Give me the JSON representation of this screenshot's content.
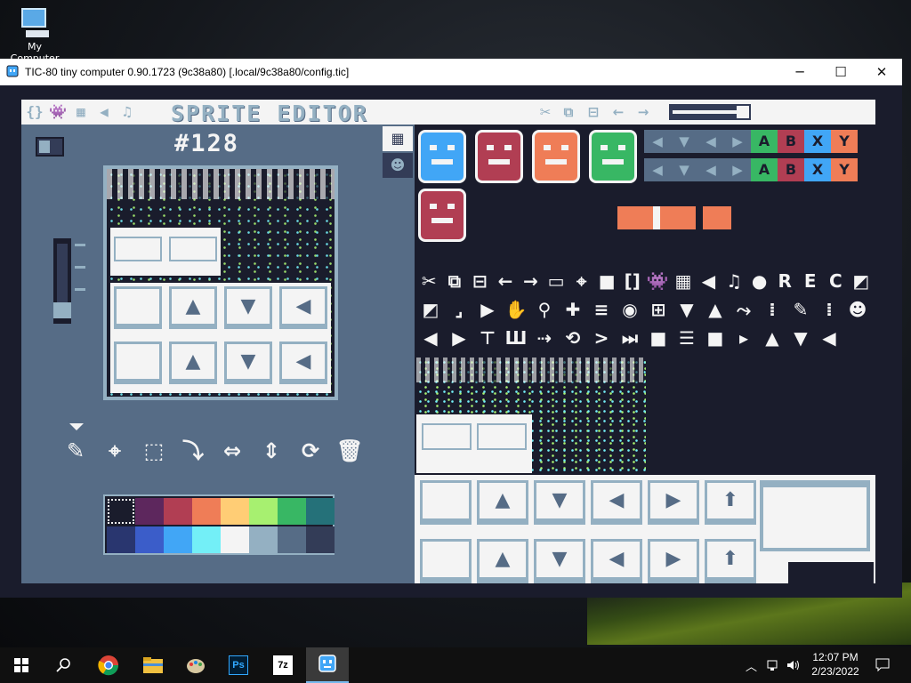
{
  "desktop": {
    "icon_label": "My Computer"
  },
  "window": {
    "title": "TIC-80 tiny computer 0.90.1723 (9c38a80) [.local/9c38a80/config.tic]",
    "minimize": "─",
    "maximize": "☐",
    "close": "✕"
  },
  "editor": {
    "title": "SPRITE EDITOR",
    "sprite_id": "#128",
    "mode_icons": [
      "{}",
      "👾",
      "▦",
      "◀",
      "♫"
    ],
    "tool_icons": [
      "✂",
      "⧉",
      "⊟",
      "←",
      "→"
    ],
    "draw_tools": [
      "✎",
      "⌖",
      "⬚",
      "⤵",
      "⇔",
      "⇕",
      "⟳",
      "🗑"
    ],
    "palette": [
      "#1a1c2c",
      "#5d275d",
      "#b13e53",
      "#ef7d57",
      "#ffcd75",
      "#a7f070",
      "#38b764",
      "#257179",
      "#29366f",
      "#3b5dc9",
      "#41a6f6",
      "#73eff7",
      "#f4f4f4",
      "#94b0c2",
      "#566c86",
      "#333c57"
    ],
    "selected_color_index": 0,
    "sheet_tabs": [
      "▦",
      "☻"
    ]
  },
  "sheet": {
    "faces": [
      {
        "color": "#41a6f6"
      },
      {
        "color": "#b13e53"
      },
      {
        "color": "#ef7d57"
      },
      {
        "color": "#38b764"
      },
      {
        "color": "#b13e53"
      }
    ],
    "gamepad_buttons": [
      {
        "label": "A",
        "color": "#38b764"
      },
      {
        "label": "B",
        "color": "#b13e53"
      },
      {
        "label": "X",
        "color": "#41a6f6"
      },
      {
        "label": "Y",
        "color": "#ef7d57"
      }
    ],
    "icon_row1": [
      "✂",
      "⧉",
      "⊟",
      "←",
      "→",
      "▭",
      "⌖",
      "■",
      "[]",
      "👾",
      "▦",
      "◀",
      "♫",
      "●",
      "R",
      "E",
      "C",
      "◩"
    ],
    "icon_row2": [
      "◩",
      "⌟",
      "▶",
      "✋",
      "⚲",
      "✚",
      "≡",
      "◉",
      "⊞",
      "▼",
      "▲",
      "⤳",
      "⁞",
      "✎",
      "⁞",
      "☻"
    ],
    "icon_row3": [
      "◀",
      "▶",
      "⊤",
      "Ш",
      "⇢",
      "⟲",
      ">",
      "⏭",
      "■",
      "☰",
      "■",
      "▸",
      "▲",
      "▼",
      "◀"
    ]
  },
  "taskbar": {
    "time": "12:07 PM",
    "date": "2/23/2022",
    "apps": [
      "start",
      "search",
      "chrome",
      "file-explorer",
      "paint",
      "photoshop",
      "7zip",
      "tic80"
    ],
    "app_labels": {
      "photoshop": "Ps",
      "7zip": "7z"
    }
  }
}
